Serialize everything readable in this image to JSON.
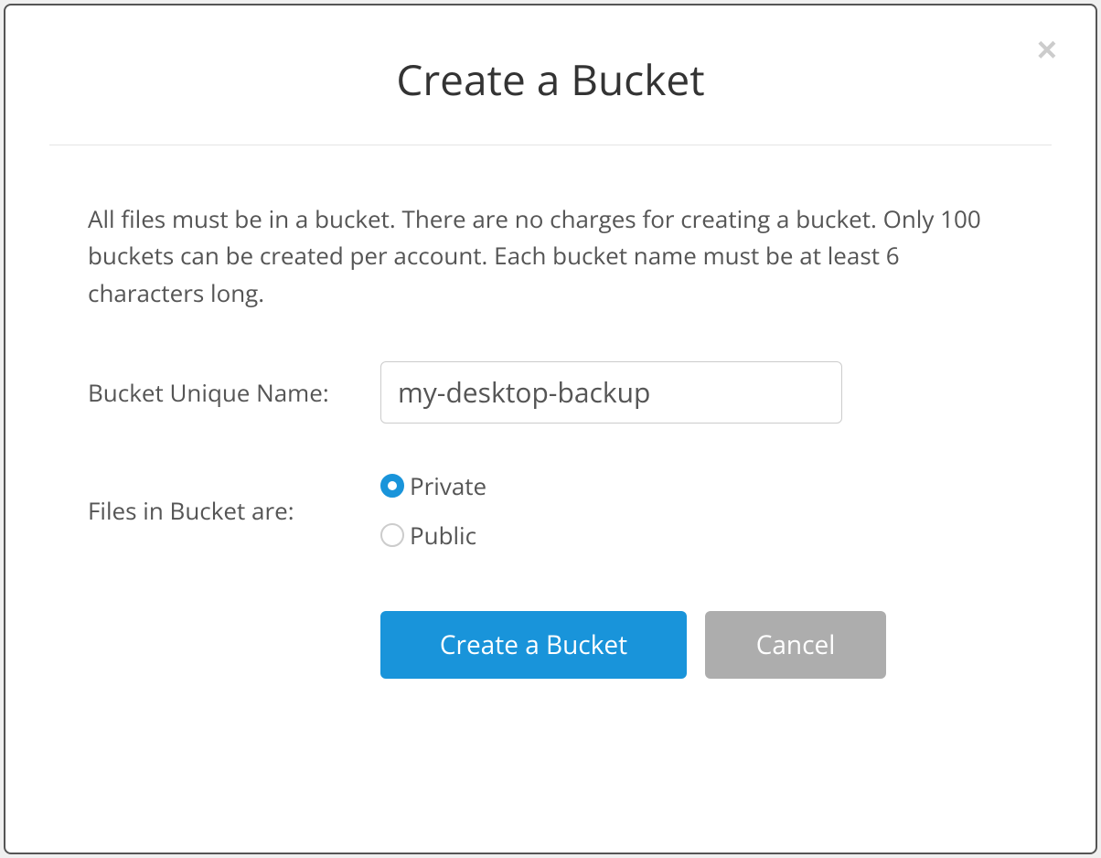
{
  "modal": {
    "title": "Create a Bucket",
    "description": "All files must be in a bucket. There are no charges for creating a bucket. Only 100 buckets can be created per account. Each bucket name must be at least 6 characters long.",
    "form": {
      "name_label": "Bucket Unique Name:",
      "name_value": "my-desktop-backup",
      "visibility_label": "Files in Bucket are:",
      "visibility_options": {
        "private": "Private",
        "public": "Public"
      },
      "visibility_selected": "private"
    },
    "buttons": {
      "submit": "Create a Bucket",
      "cancel": "Cancel"
    }
  }
}
